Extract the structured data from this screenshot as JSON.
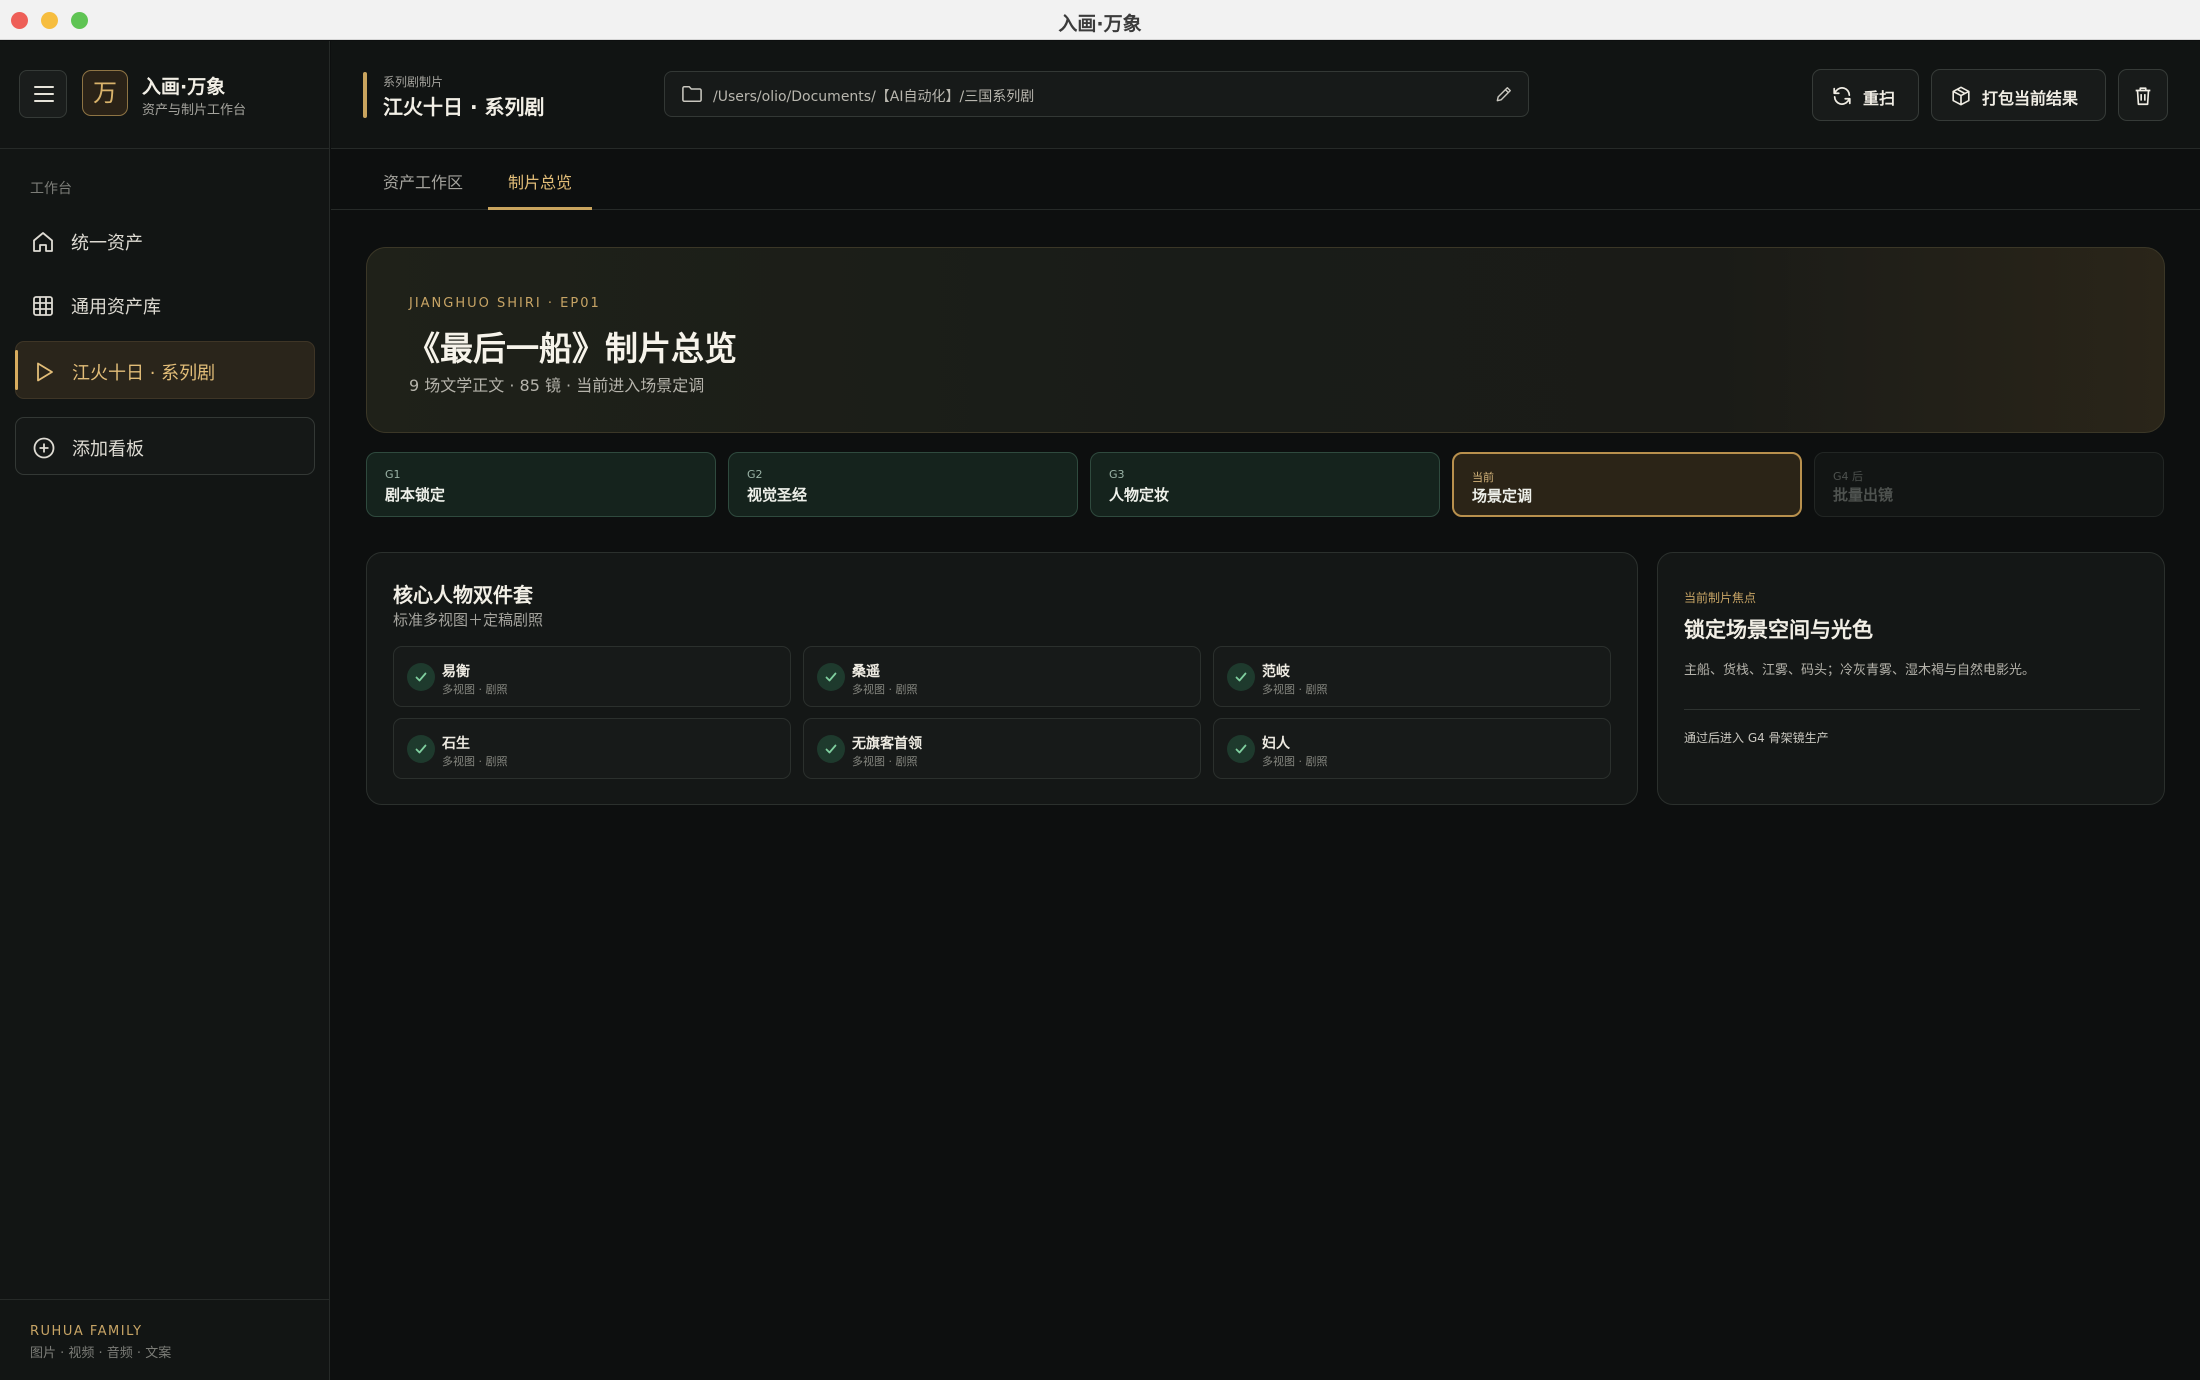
{
  "window": {
    "title": "入画·万象"
  },
  "sidebar": {
    "brand": {
      "logo_char": "万",
      "name": "入画·万象",
      "subtitle": "资产与制片工作台"
    },
    "section_label": "工作台",
    "items": [
      {
        "label": "统一资产",
        "icon": "home-icon"
      },
      {
        "label": "通用资产库",
        "icon": "grid-icon"
      },
      {
        "label": "江火十日 · 系列剧",
        "icon": "play-icon",
        "active": true
      }
    ],
    "add_board_label": "添加看板",
    "footer": {
      "brand": "RUHUA FAMILY",
      "subtitle": "图片 · 视频 · 音频 · 文案"
    }
  },
  "header": {
    "project_kicker": "系列剧制片",
    "project_title": "江火十日 · 系列剧",
    "path": "/Users/olio/Documents/【AI自动化】/三国系列剧",
    "buttons": {
      "rescan": "重扫",
      "pack": "打包当前结果"
    }
  },
  "tabs": [
    {
      "label": "资产工作区",
      "active": false
    },
    {
      "label": "制片总览",
      "active": true
    }
  ],
  "hero": {
    "kicker": "JIANGHUO SHIRI · EP01",
    "title": "《最后一船》制片总览",
    "subtitle": "9 场文学正文 · 85 镜 · 当前进入场景定调"
  },
  "stages": [
    {
      "code": "G1",
      "name": "剧本锁定",
      "status": "done"
    },
    {
      "code": "G2",
      "name": "视觉圣经",
      "status": "done"
    },
    {
      "code": "G3",
      "name": "人物定妆",
      "status": "done"
    },
    {
      "code": "当前",
      "name": "场景定调",
      "status": "current"
    },
    {
      "code": "G4 后",
      "name": "批量出镜",
      "status": "future"
    }
  ],
  "characters": {
    "title": "核心人物双件套",
    "subtitle": "标准多视图＋定稿剧照",
    "items": [
      {
        "name": "易衡",
        "tag": "多视图 · 剧照"
      },
      {
        "name": "桑遥",
        "tag": "多视图 · 剧照"
      },
      {
        "name": "范岐",
        "tag": "多视图 · 剧照"
      },
      {
        "name": "石生",
        "tag": "多视图 · 剧照"
      },
      {
        "name": "无旗客首领",
        "tag": "多视图 · 剧照"
      },
      {
        "name": "妇人",
        "tag": "多视图 · 剧照"
      }
    ]
  },
  "focus": {
    "kicker": "当前制片焦点",
    "title": "锁定场景空间与光色",
    "description": "主船、货栈、江雾、码头；冷灰青雾、湿木褐与自然电影光。",
    "note": "通过后进入 G4 骨架镜生产"
  },
  "colors": {
    "accent": "#c9a45e",
    "done_green": "#15231d",
    "background": "#0d0f0f"
  }
}
